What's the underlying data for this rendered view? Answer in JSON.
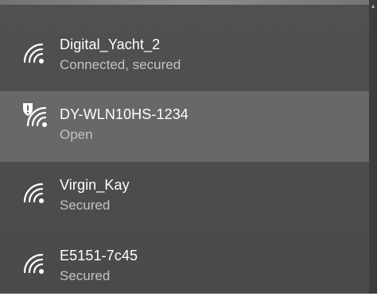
{
  "networks": [
    {
      "name": "Digital_Yacht_2",
      "status": "Connected, secured",
      "icon": "wifi-signal-icon",
      "selected": false
    },
    {
      "name": "DY-WLN10HS-1234",
      "status": "Open",
      "icon": "wifi-open-warning-icon",
      "selected": true
    },
    {
      "name": "Virgin_Kay",
      "status": "Secured",
      "icon": "wifi-signal-icon",
      "selected": false
    },
    {
      "name": "E5151-7c45",
      "status": "Secured",
      "icon": "wifi-signal-icon",
      "selected": false
    }
  ],
  "colors": {
    "panel": "#4d4d4d",
    "selected": "#686868",
    "text_primary": "#ffffff",
    "text_secondary": "#c3c3c3"
  }
}
